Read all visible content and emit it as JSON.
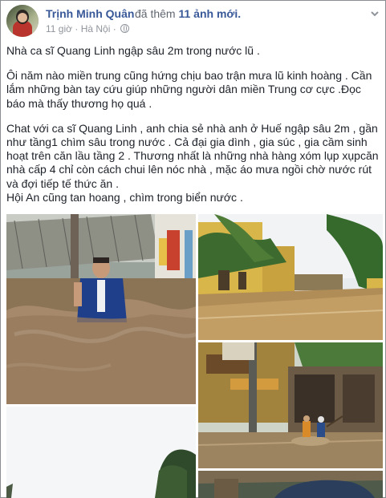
{
  "post": {
    "author": "Trịnh Minh Quân",
    "action": "đã thêm",
    "photo_count": "11 ảnh mới.",
    "time": "11 giờ",
    "separator": "·",
    "location": "Hà Nội",
    "separator2": "·",
    "privacy_icon": "globe-icon",
    "menu_icon": "chevron-down-icon",
    "paragraphs": [
      "Nhà ca sĩ Quang Linh ngập sâu 2m trong nước lũ .",
      "Ôi năm nào miền trung cũng hứng chịu bao trận mưa lũ kinh hoàng . Cần lắm những bàn tay cứu giúp những người dân miền Trung cơ cực .Đọc báo mà thấy thương họ quá .",
      "Chat với ca sĩ Quang Linh , anh chia sẻ nhà anh ở Huế ngập sâu 2m , gần như tầng1 chìm sâu trong nước . Cả đại gia dình , gia súc , gia cầm sinh hoạt trên căn lầu tầng 2 . Thương nhất là những nhà hàng xóm lụp xụpcăn nhà cấp 4 chỉ còn cách chui lên nóc nhà , mặc áo mưa ngồi chờ nước rút và đợi tiếp tế thức ăn .",
      "Hội An cũng tan hoang , chìm trong biển nước ."
    ]
  },
  "photos": [
    {
      "name": "photo-flooded-house-man"
    },
    {
      "name": "photo-flooded-street-yellow-houses"
    },
    {
      "name": "photo-boat-flooded-street"
    },
    {
      "name": "photo-sky-tree"
    },
    {
      "name": "photo-umbrella-bottom"
    }
  ]
}
